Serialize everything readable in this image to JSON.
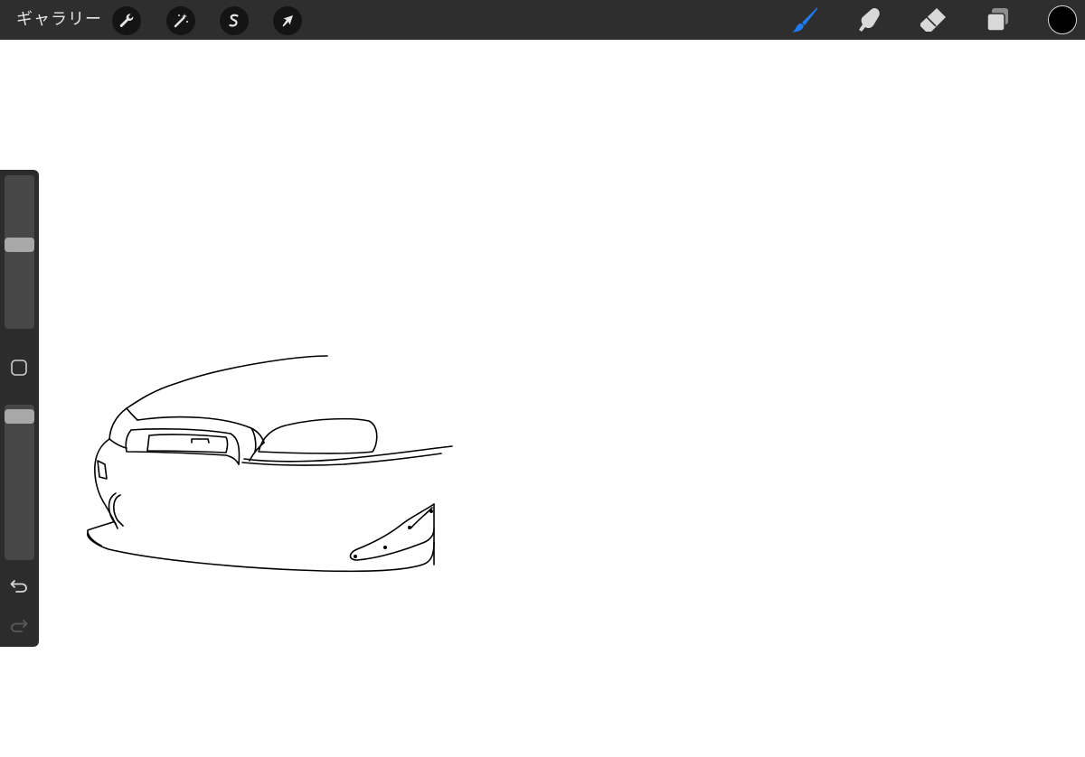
{
  "app": {
    "gallery_label": "ギャラリー"
  },
  "toolbar_left": {
    "items": [
      {
        "name": "actions",
        "icon": "wrench-icon"
      },
      {
        "name": "adjustments",
        "icon": "magic-wand-icon"
      },
      {
        "name": "selection",
        "icon": "selection-s-icon"
      },
      {
        "name": "transform",
        "icon": "arrow-cursor-icon"
      }
    ]
  },
  "toolbar_right": {
    "items": [
      {
        "name": "brush",
        "icon": "brush-icon",
        "active": true
      },
      {
        "name": "smudge",
        "icon": "smudge-finger-icon",
        "active": false
      },
      {
        "name": "eraser",
        "icon": "eraser-icon",
        "active": false
      },
      {
        "name": "layers",
        "icon": "layers-icon",
        "active": false
      }
    ],
    "color": "#000000",
    "accent": "#1e7bf0"
  },
  "sidebar": {
    "brush_size_level": 0.55,
    "opacity_level": 0.97,
    "icons": [
      "square-modify-icon",
      "undo-arrow-icon",
      "redo-arrow-icon"
    ]
  },
  "canvas": {
    "background": "#ffffff",
    "stroke_color": "#000000"
  }
}
